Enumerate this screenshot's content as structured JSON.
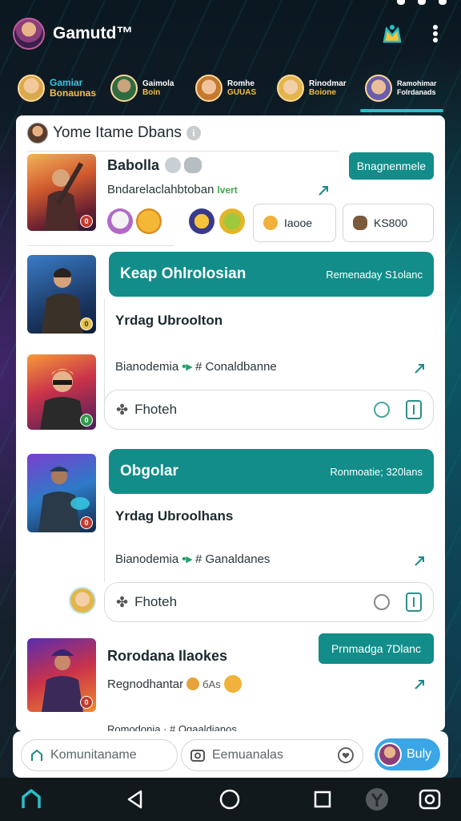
{
  "header": {
    "app_title": "Gamutd™"
  },
  "categories": [
    {
      "line1": "Gamiar",
      "line2": "Bonaunas",
      "active": false
    },
    {
      "line1": "Gaimola",
      "line2": "Boin",
      "active": false
    },
    {
      "line1": "Romhe",
      "line2": "GUUAS",
      "active": false
    },
    {
      "line1": "Rinodmar",
      "line2": "Boione",
      "active": false
    },
    {
      "line1": "Ramohimar",
      "line2": "Folrdanads",
      "active": true
    }
  ],
  "card": {
    "title": "Yome Itame Dbans",
    "post1": {
      "name": "Babolla",
      "subtitle": "Bndarelaclahbtoban",
      "tag": "lvert",
      "button": "Bnagnenmele",
      "badge": "0",
      "chip1": "Iaooe",
      "chip2": "KS800"
    },
    "thread1": {
      "banner_title": "Keap Ohlrolosian",
      "banner_right": "Remenaday S1olanc",
      "reply_title": "Yrdag Ubroolton",
      "meta_user": "Bianodemia",
      "meta_tag": "# Conaldbanne",
      "action": "Fhoteh"
    },
    "thread2": {
      "banner_title": "Obgolar",
      "banner_right": "Ronmoatie; 320lans",
      "reply_title": "Yrdag Ubroolhans",
      "meta_user": "Bianodemia",
      "meta_tag": "# Ganaldanes",
      "action": "Fhoteh"
    },
    "post2": {
      "name": "Rorodana Ilaokes",
      "subtitle": "Regnodhantar",
      "tag": "бAs",
      "button": "Prnmadga 7Dlanc",
      "preview": "Romodonia  · # Ogaaldianos"
    }
  },
  "input_bar": {
    "community_placeholder": "Komunitaname",
    "comment_placeholder": "Eemuanalas",
    "send_label": "Buly"
  },
  "colors": {
    "accent": "#128d8a",
    "underline": "#27c0c8",
    "send": "#3aa6e6"
  }
}
